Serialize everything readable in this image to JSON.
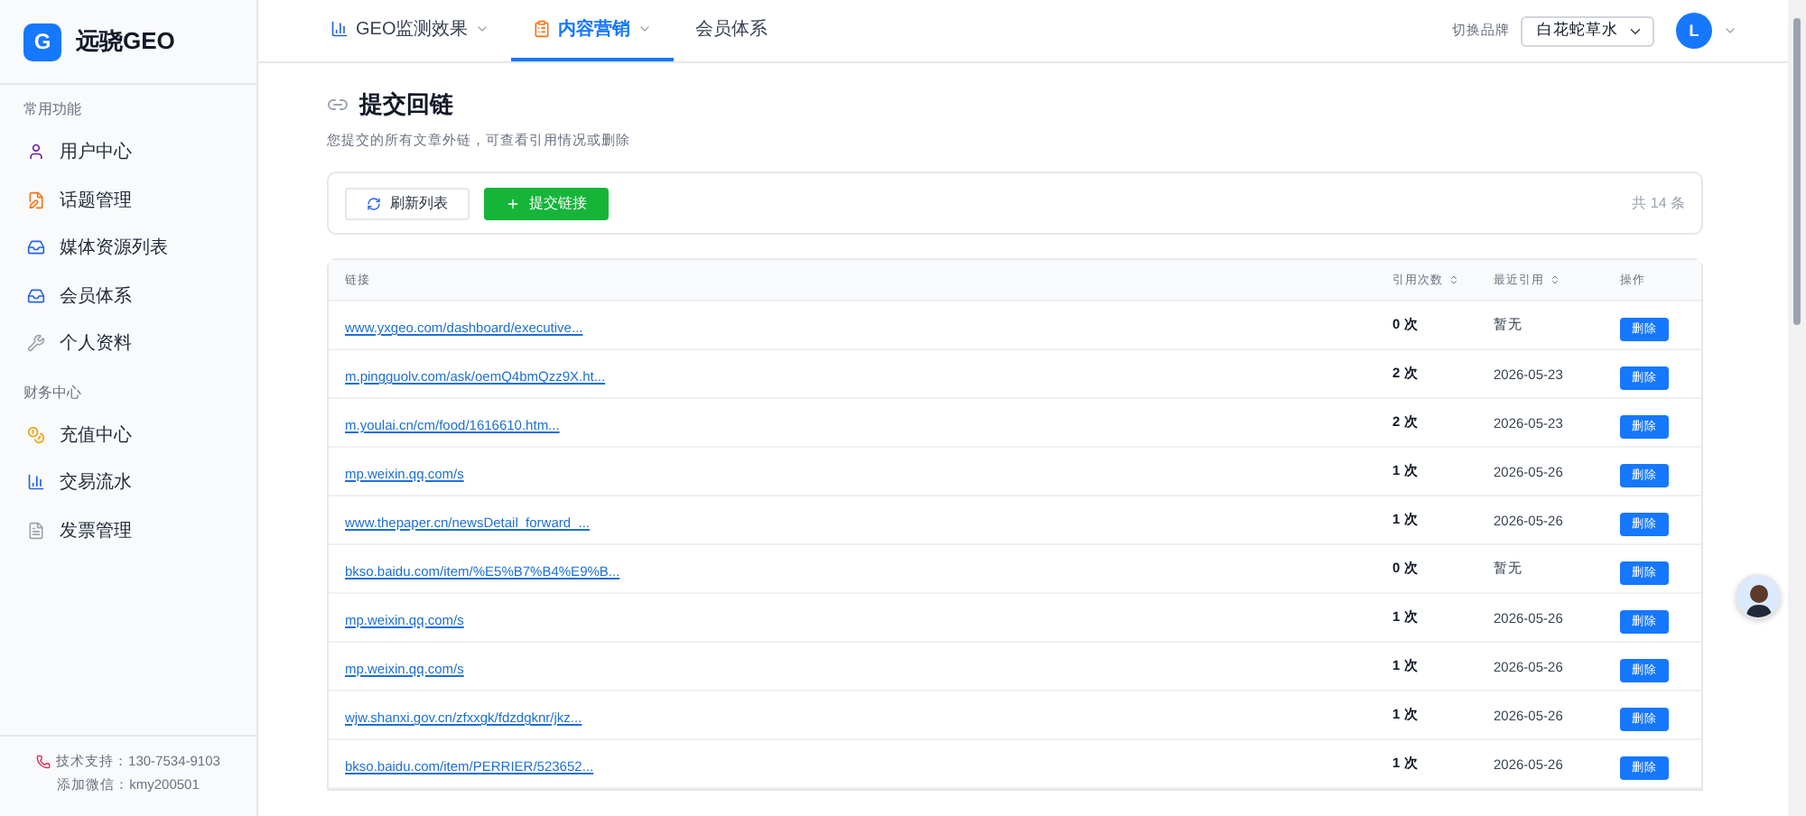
{
  "sidebar": {
    "logo": {
      "letter": "G",
      "name": "远骁GEO"
    },
    "sections": [
      {
        "title": "常用功能",
        "items": [
          {
            "label": "用户中心",
            "selected": false
          },
          {
            "label": "话题管理",
            "selected": false
          },
          {
            "label": "媒体资源列表",
            "selected": false
          },
          {
            "label": "会员体系",
            "selected": false
          },
          {
            "label": "个人资料",
            "selected": false
          }
        ]
      },
      {
        "title": "财务中心",
        "items": [
          {
            "label": "充值中心",
            "selected": false
          },
          {
            "label": "交易流水",
            "selected": false
          },
          {
            "label": "发票管理",
            "selected": false
          }
        ]
      }
    ],
    "footer": {
      "support": "技术支持：130-7534-9103",
      "wechat": "添加微信：kmy200501"
    }
  },
  "topbar": {
    "tabs": [
      {
        "label": "GEO监测效果",
        "selected": false,
        "dropdown": true
      },
      {
        "label": "内容营销",
        "selected": true,
        "dropdown": true
      },
      {
        "label": "会员体系",
        "selected": false,
        "dropdown": false
      }
    ],
    "brand_label": "切换品牌",
    "brand_select": "白花蛇草水",
    "user_initial": "L"
  },
  "page": {
    "title": "提交回链",
    "subtitle": "您提交的所有文章外链，可查看引用情况或删除",
    "refresh_button": "刷新列表",
    "submit_button": "提交链接",
    "total": "共 14 条"
  },
  "table": {
    "columns": [
      {
        "label": "链接",
        "sortable": false
      },
      {
        "label": "引用次数",
        "sortable": true
      },
      {
        "label": "最近引用",
        "sortable": true
      },
      {
        "label": "操作",
        "sortable": false
      }
    ],
    "rows": [
      {
        "link": "www.yxgeo.com/dashboard/executive...",
        "count": "0 次",
        "last": "暂无",
        "action": "删除"
      },
      {
        "link": "m.pingguolv.com/ask/oemQ4bmQzz9X.ht...",
        "count": "2 次",
        "last": "2026-05-23",
        "action": "删除"
      },
      {
        "link": "m.youlai.cn/cm/food/1616610.htm...",
        "count": "2 次",
        "last": "2026-05-23",
        "action": "删除"
      },
      {
        "link": "mp.weixin.qq.com/s",
        "count": "1 次",
        "last": "2026-05-26",
        "action": "删除"
      },
      {
        "link": "www.thepaper.cn/newsDetail_forward_...",
        "count": "1 次",
        "last": "2026-05-26",
        "action": "删除"
      },
      {
        "link": "bkso.baidu.com/item/%E5%B7%B4%E9%B...",
        "count": "0 次",
        "last": "暂无",
        "action": "删除"
      },
      {
        "link": "mp.weixin.qq.com/s",
        "count": "1 次",
        "last": "2026-05-26",
        "action": "删除"
      },
      {
        "link": "mp.weixin.qq.com/s",
        "count": "1 次",
        "last": "2026-05-26",
        "action": "删除"
      },
      {
        "link": "wjw.shanxi.gov.cn/zfxxgk/fdzdgknr/jkz...",
        "count": "1 次",
        "last": "2026-05-26",
        "action": "删除"
      },
      {
        "link": "bkso.baidu.com/item/PERRIER/523652...",
        "count": "1 次",
        "last": "2026-05-26",
        "action": "删除"
      }
    ]
  }
}
